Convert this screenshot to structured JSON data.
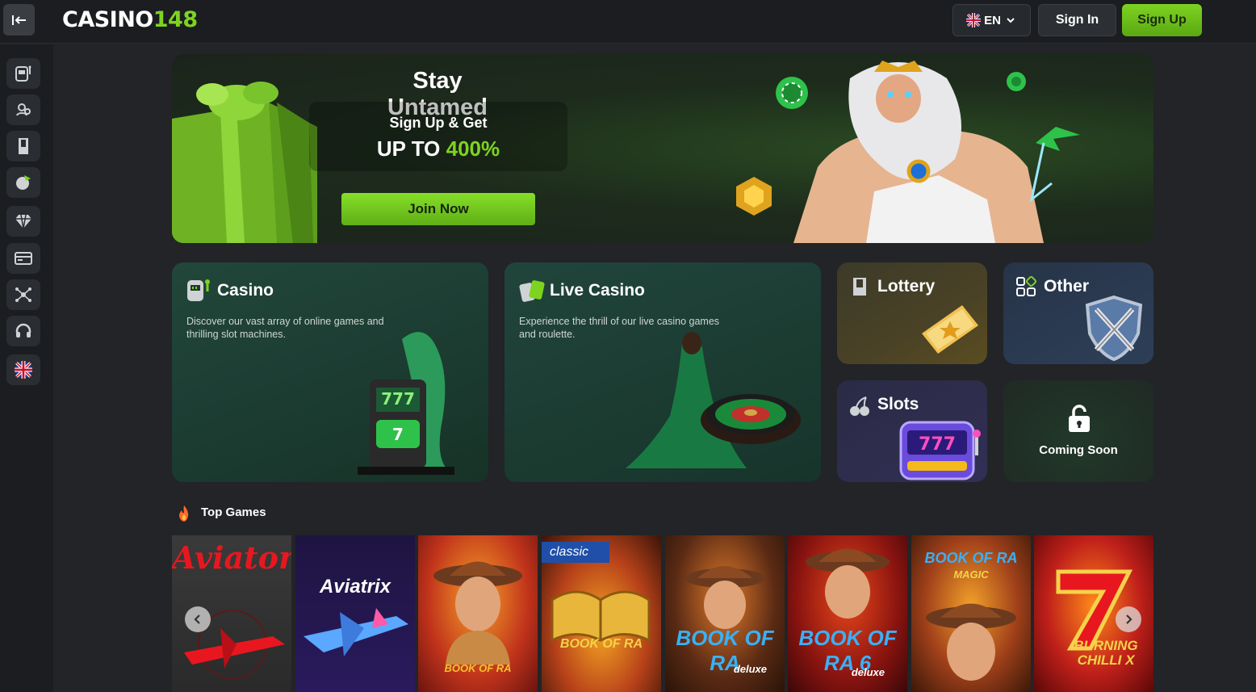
{
  "header": {
    "logo_main": "CASINO",
    "logo_accent": "148",
    "language": "EN",
    "signin_label": "Sign In",
    "signup_label": "Sign Up"
  },
  "sidebar": {
    "items": [
      "casino-icon",
      "live-casino-icon",
      "lottery-icon",
      "sports-icon",
      "vip-icon",
      "payments-icon",
      "network-icon",
      "support-icon",
      "language-flag-icon"
    ]
  },
  "hero": {
    "title": "Stay Untamed",
    "offer_line1": "Sign Up & Get",
    "offer_prefix": "UP TO ",
    "offer_value": "400%",
    "cta_label": "Join Now"
  },
  "categories": {
    "casino": {
      "title": "Casino",
      "desc": "Discover our vast array of online games and thrilling slot machines."
    },
    "live": {
      "title": "Live Casino",
      "desc": "Experience the thrill of our live casino games and roulette."
    },
    "lottery": {
      "title": "Lottery"
    },
    "other": {
      "title": "Other"
    },
    "slots": {
      "title": "Slots"
    },
    "soon": {
      "title": "Coming Soon"
    }
  },
  "top_games": {
    "title": "Top Games",
    "games": [
      {
        "name": "Aviator"
      },
      {
        "name": "Aviatrix"
      },
      {
        "name": "BOOK OF RA"
      },
      {
        "name": "BOOK OF RA",
        "tag": "classic"
      },
      {
        "name": "BOOK OF RA",
        "sub": "deluxe"
      },
      {
        "name": "BOOK OF RA 6",
        "sub": "deluxe"
      },
      {
        "name": "BOOK OF RA",
        "sub": "MAGIC"
      },
      {
        "name": "BURNING CHILLI X"
      }
    ]
  },
  "colors": {
    "accent": "#7ed321",
    "background": "#222427",
    "header": "#1b1d20"
  }
}
